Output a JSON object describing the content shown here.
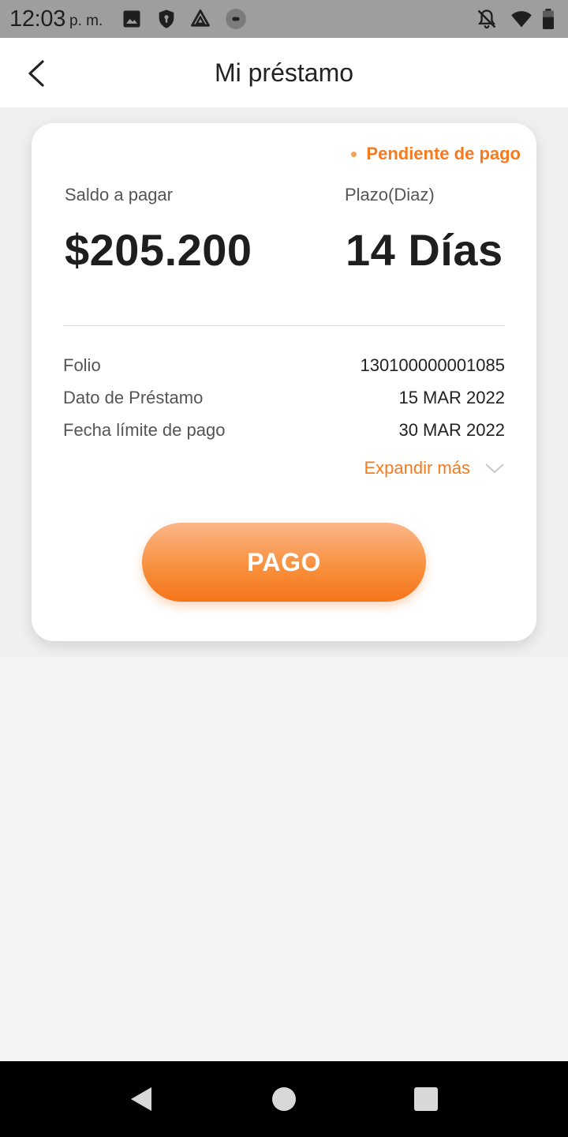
{
  "status_bar": {
    "time": "12:03",
    "ampm": "p. m."
  },
  "header": {
    "title": "Mi préstamo",
    "back_icon": "chevron-left-icon"
  },
  "loan_card": {
    "status": "Pendiente de pago",
    "balance_label": "Saldo a pagar",
    "balance_value": "$205.200",
    "term_label": "Plazo(Diaz)",
    "term_value": "14 Días",
    "details": [
      {
        "label": "Folio",
        "value": "130100000001085"
      },
      {
        "label": "Dato de Préstamo",
        "value": "15 MAR 2022"
      },
      {
        "label": "Fecha límite de pago",
        "value": "30 MAR 2022"
      }
    ],
    "expand_label": "Expandir más",
    "pay_button": "PAGO"
  },
  "colors": {
    "accent": "#f47b20",
    "status_bar": "#9e9e9e",
    "background": "#f4f4f4"
  }
}
